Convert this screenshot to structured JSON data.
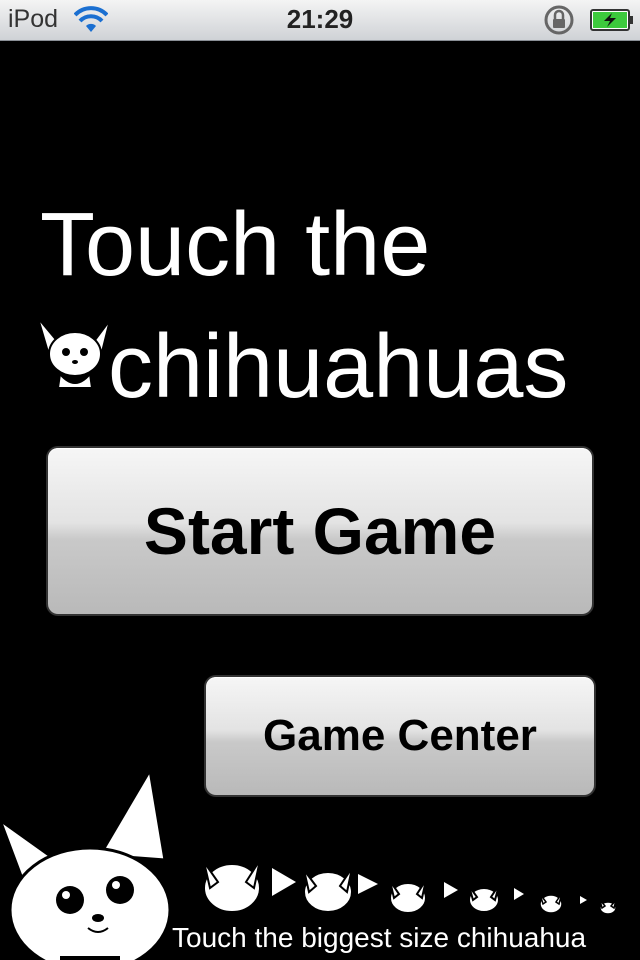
{
  "status_bar": {
    "carrier": "iPod",
    "time": "21:29",
    "icons": [
      "wifi-icon",
      "orientation-lock-icon",
      "battery-charging-icon"
    ]
  },
  "title": {
    "line1": "Touch the",
    "line2": "chihuahuas"
  },
  "buttons": {
    "start": "Start Game",
    "game_center": "Game Center"
  },
  "footer": {
    "hint": "Touch the biggest size chihuahua"
  },
  "colors": {
    "background": "#000000",
    "text": "#ffffff",
    "battery_fill": "#3cc93c"
  }
}
